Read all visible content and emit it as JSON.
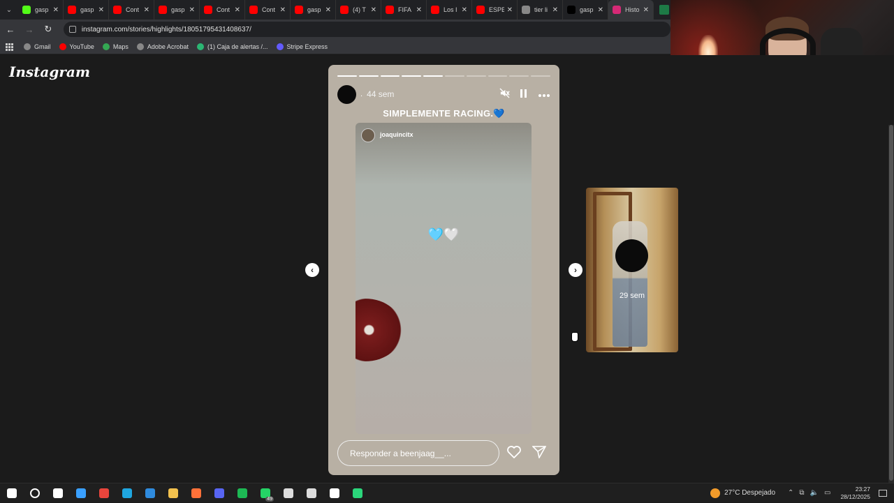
{
  "browser": {
    "tabs": [
      {
        "title": "gasp",
        "icon": "kick-icon",
        "color": "#53fc18"
      },
      {
        "title": "gasp",
        "icon": "youtube-icon",
        "color": "#ff0000"
      },
      {
        "title": "Cont",
        "icon": "youtube-icon",
        "color": "#ff0000"
      },
      {
        "title": "gasp",
        "icon": "youtube-icon",
        "color": "#ff0000"
      },
      {
        "title": "Cont",
        "icon": "youtube-icon",
        "color": "#ff0000"
      },
      {
        "title": "Cont",
        "icon": "youtube-icon",
        "color": "#ff0000"
      },
      {
        "title": "gasp",
        "icon": "youtube-icon",
        "color": "#ff0000"
      },
      {
        "title": "(4) T",
        "icon": "youtube-icon",
        "color": "#ff0000"
      },
      {
        "title": "FIFA",
        "icon": "youtube-icon",
        "color": "#ff0000"
      },
      {
        "title": "Los I",
        "icon": "youtube-icon",
        "color": "#ff0000"
      },
      {
        "title": "ESPE",
        "icon": "youtube-icon",
        "color": "#ff0000"
      },
      {
        "title": "tier li",
        "icon": "globe-icon",
        "color": "#888888"
      },
      {
        "title": "gasp",
        "icon": "tiktok-icon",
        "color": "#000000"
      },
      {
        "title": "Histo",
        "icon": "instagram-icon",
        "color": "#d62976"
      }
    ],
    "url": "instagram.com/stories/highlights/18051795431408637/",
    "bookmarks": [
      {
        "label": "Gmail",
        "icon": "globe-icon",
        "color": "#888888"
      },
      {
        "label": "YouTube",
        "icon": "youtube-icon",
        "color": "#ff0000"
      },
      {
        "label": "Maps",
        "icon": "maps-icon",
        "color": "#34a853"
      },
      {
        "label": "Adobe Acrobat",
        "icon": "globe-icon",
        "color": "#888888"
      },
      {
        "label": "(1) Caja de alertas /...",
        "icon": "alerts-icon",
        "color": "#2bb673"
      },
      {
        "label": "Stripe Express",
        "icon": "stripe-icon",
        "color": "#635bff"
      }
    ]
  },
  "instagram": {
    "logo": "Instagram",
    "story": {
      "progress_total": 10,
      "progress_done": 5,
      "username": ".",
      "time": "44 sem",
      "caption": "SIMPLEMENTE RACING.💙",
      "inner_username": "joaquincitx",
      "inner_text": "🩵🤍",
      "reply_placeholder": "Responder a beenjaag__..."
    },
    "next_story": {
      "time": "29 sem"
    }
  },
  "taskbar": {
    "apps": [
      {
        "name": "windows-start-icon",
        "color": "#ffffff"
      },
      {
        "name": "search-icon",
        "color": "#ffffff"
      },
      {
        "name": "task-view-icon",
        "color": "#ffffff"
      },
      {
        "name": "copilot-icon",
        "color": "#3aa0ff"
      },
      {
        "name": "chrome-icon",
        "color": "#e8453c"
      },
      {
        "name": "edge-icon",
        "color": "#1fa6e0"
      },
      {
        "name": "store-icon",
        "color": "#2f8bde"
      },
      {
        "name": "file-explorer-icon",
        "color": "#f2c14e"
      },
      {
        "name": "firefox-icon",
        "color": "#ff7139"
      },
      {
        "name": "discord-icon",
        "color": "#5865f2"
      },
      {
        "name": "spotify-icon",
        "color": "#1db954"
      },
      {
        "name": "whatsapp-icon",
        "color": "#25d366",
        "badge": "49"
      },
      {
        "name": "media-player-icon",
        "color": "#dddddd"
      },
      {
        "name": "obs-icon",
        "color": "#dddddd"
      },
      {
        "name": "capcut-icon",
        "color": "#ffffff"
      },
      {
        "name": "app-icon",
        "color": "#2bd67b"
      }
    ],
    "weather": "27°C  Despejado",
    "time": "23:27",
    "date": "28/12/2025"
  }
}
